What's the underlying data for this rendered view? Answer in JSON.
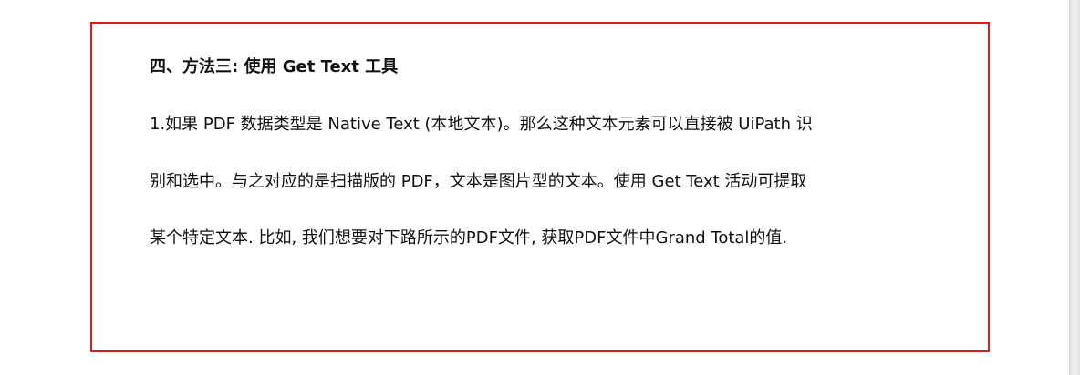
{
  "document": {
    "heading": "四、方法三: 使用 Get Text 工具",
    "paragraph_lines": [
      "1.如果 PDF 数据类型是 Native Text (本地文本)。那么这种文本元素可以直接被 UiPath 识",
      "别和选中。与之对应的是扫描版的 PDF，文本是图片型的文本。使用 Get Text 活动可提取",
      "某个特定文本. 比如, 我们想要对下路所示的PDF文件, 获取PDF文件中Grand Total的值."
    ]
  },
  "colors": {
    "frame_border": "#d81e1e",
    "text": "#111111",
    "background": "#ffffff",
    "scrollbar_track": "#e4e4e4"
  }
}
